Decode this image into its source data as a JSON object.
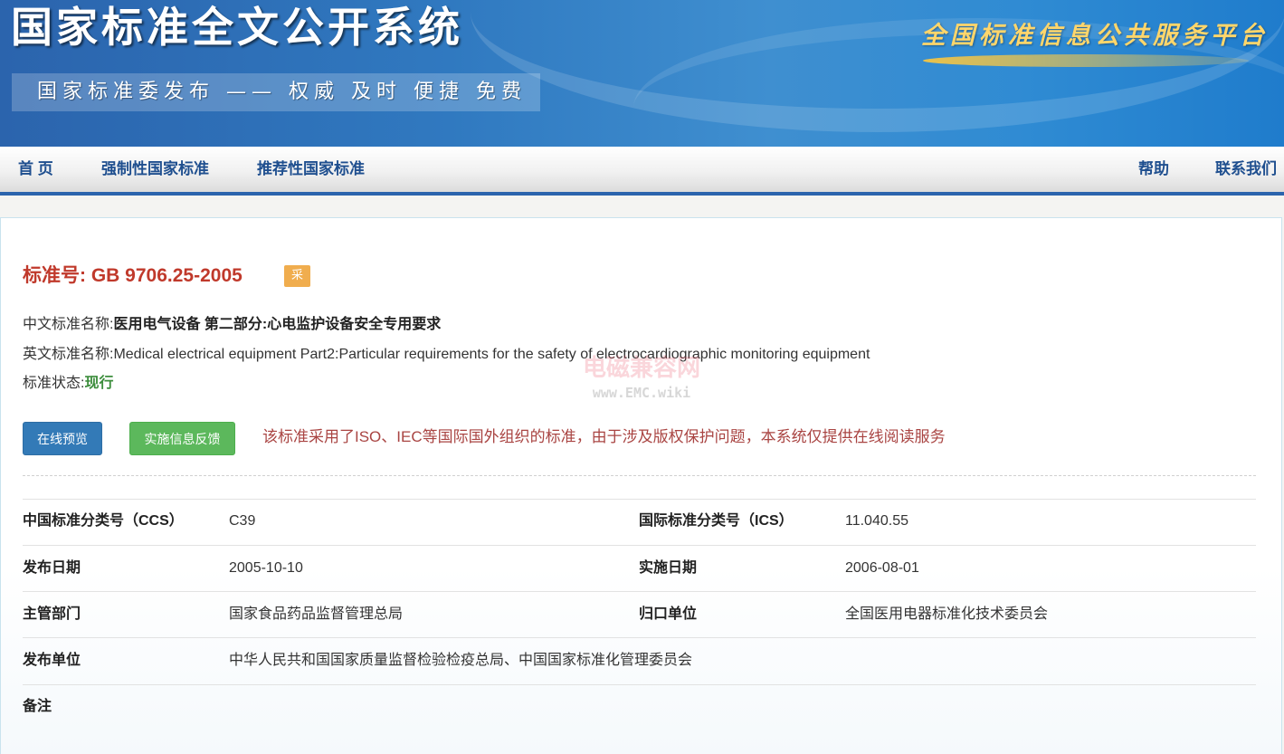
{
  "banner": {
    "title": "国家标准全文公开系统",
    "subtitle": "国家标准委发布 —— 权威 及时 便捷 免费",
    "platform": "全国标准信息公共服务平台"
  },
  "nav": {
    "home": "首 页",
    "mandatory": "强制性国家标准",
    "recommended": "推荐性国家标准",
    "help": "帮助",
    "contact": "联系我们"
  },
  "standard": {
    "number_label": "标准号:",
    "number": "GB 9706.25-2005",
    "badge": "采",
    "cn_name_label": "中文标准名称:",
    "cn_name": "医用电气设备 第二部分:心电监护设备安全专用要求",
    "en_name_label": "英文标准名称:",
    "en_name": "Medical electrical equipment Part2:Particular requirements for the safety of electrocardiographic monitoring equipment",
    "status_label": "标准状态:",
    "status": "现行"
  },
  "actions": {
    "preview": "在线预览",
    "feedback": "实施信息反馈",
    "notice": "该标准采用了ISO、IEC等国际国外组织的标准，由于涉及版权保护问题，本系统仅提供在线阅读服务"
  },
  "info": {
    "ccs_label": "中国标准分类号（CCS）",
    "ccs": "C39",
    "ics_label": "国际标准分类号（ICS）",
    "ics": "11.040.55",
    "pub_date_label": "发布日期",
    "pub_date": "2005-10-10",
    "impl_date_label": "实施日期",
    "impl_date": "2006-08-01",
    "dept_label": "主管部门",
    "dept": "国家食品药品监督管理总局",
    "tc_label": "归口单位",
    "tc": "全国医用电器标准化技术委员会",
    "issuer_label": "发布单位",
    "issuer": "中华人民共和国国家质量监督检验检疫总局、中国国家标准化管理委员会",
    "remark_label": "备注"
  },
  "watermark": {
    "cn": "电磁兼容网",
    "url": "www.EMC.wiki"
  }
}
